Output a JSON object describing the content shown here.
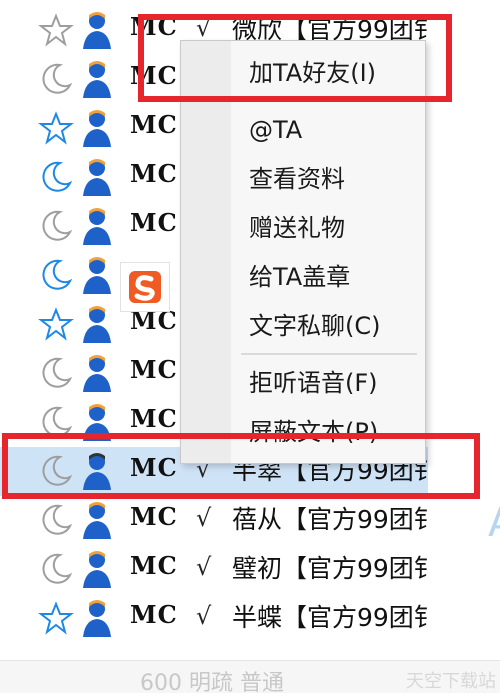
{
  "contacts": [
    {
      "status": "star",
      "tag": "MC",
      "check": "√",
      "nick": "微欣【官方99团钅"
    },
    {
      "status": "moon",
      "tag": "MC",
      "check": "√",
      "nick": ""
    },
    {
      "status": "star",
      "tag": "MC",
      "check": "√",
      "nick": ""
    },
    {
      "status": "moon",
      "tag": "MC",
      "check": "√",
      "nick": ""
    },
    {
      "status": "moon",
      "tag": "MC",
      "check": "√",
      "nick": ""
    },
    {
      "status": "moon",
      "tag": "",
      "check": "",
      "nick": ""
    },
    {
      "status": "star",
      "tag": "MC",
      "check": "√",
      "nick": ""
    },
    {
      "status": "moon",
      "tag": "MC",
      "check": "√",
      "nick": ""
    },
    {
      "status": "moon",
      "tag": "MC",
      "check": "√",
      "nick": ""
    },
    {
      "status": "moon",
      "tag": "MC",
      "check": "√",
      "nick": "半翠【官方99团钅"
    },
    {
      "status": "moon",
      "tag": "MC",
      "check": "√",
      "nick": "蓓从【官方99团钅"
    },
    {
      "status": "moon",
      "tag": "MC",
      "check": "√",
      "nick": "璧初【官方99团钅"
    },
    {
      "status": "star",
      "tag": "MC",
      "check": "√",
      "nick": "半蝶【官方99团钅"
    }
  ],
  "context_menu": {
    "items": [
      {
        "label": "加TA好友(I)",
        "highlight": true
      },
      {
        "label": "@TA"
      },
      {
        "label": "查看资料"
      },
      {
        "label": "赠送礼物"
      },
      {
        "label": "给TA盖章"
      },
      {
        "label": "文字私聊(C)"
      },
      {
        "label": "拒听语音(F)"
      },
      {
        "label": "屏蔽文本(P)"
      }
    ]
  },
  "footer": {
    "text": "600 明疏 普通",
    "watermark": "天空下载站"
  },
  "right_edge_glyph": "A",
  "colors": {
    "highlight": "#e6262d",
    "selected_row": "#cfe3f7",
    "star": "#1e88e5",
    "moon": "#9e9e9e",
    "avatar": "#1e62c9"
  }
}
